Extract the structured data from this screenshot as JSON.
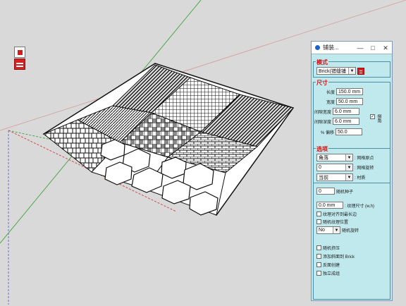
{
  "window": {
    "title": "铺装..."
  },
  "controls": {
    "minimize": "—",
    "maximize": "□",
    "close": "✕"
  },
  "mode": {
    "section_title": "模式",
    "selected": "Brick(错缝铺",
    "arrow_icon": "chevron-down-icon"
  },
  "size": {
    "section_title": "尺寸",
    "fields": [
      {
        "label": "长度",
        "value": "150.0 mm"
      },
      {
        "label": "宽度",
        "value": "50.0 mm"
      },
      {
        "label": "间隙宽度",
        "value": "6.0 mm"
      },
      {
        "label": "间隙深度",
        "value": "6.0 mm"
      },
      {
        "label": "% 偏移",
        "value": "50.0"
      }
    ],
    "bevel_label": "倒角",
    "bevel_checked": true
  },
  "options": {
    "section_title": "选项",
    "dropdown_rows": [
      {
        "value": "角落",
        "label": ": 网格原点"
      },
      {
        "value": "0",
        "label": ": 网格旋转"
      },
      {
        "value": "当前",
        "label": ": 材质"
      }
    ],
    "random_seed_value": "0",
    "random_seed_label": "随机种子",
    "texture_size_value": "0.0 mm",
    "texture_size_label": ": 纹理尺寸 (w,h)",
    "checks_1": [
      {
        "label": "纹理对齐到最长边",
        "checked": false
      },
      {
        "label": "随机纹理位置",
        "checked": false
      }
    ],
    "rotation_value": "No",
    "rotation_label": "随机旋转",
    "checks_2": [
      {
        "label": "随机挤压",
        "checked": false
      },
      {
        "label": "添加斜面到 Brick",
        "checked": false
      },
      {
        "label": "反面创建",
        "checked": false
      },
      {
        "label": "独立成组",
        "checked": false
      }
    ]
  },
  "colors": {
    "panel_bg": "#bfe9ed",
    "section_title": "#cf1111",
    "border": "#4f8fa5"
  }
}
